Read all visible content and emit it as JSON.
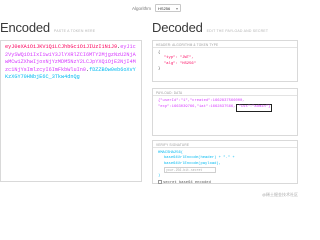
{
  "algorithm": {
    "label": "Algorithm",
    "selected": "HS256"
  },
  "encoded": {
    "title": "Encoded",
    "subtitle": "PASTE A TOKEN HERE",
    "token_header": "eyJ0eXAiOiJKV1QiLCJhbGciOiJIUzI1NiJ9",
    "token_payload": "eyJ1c2VySWQiOiIxIiwiY3JlYXRlZCI6MTY2MjgzNzU2NjAwMCwiZXhwIjoxNjYzMDM5NzY2LCJpYXQiOjE2NjI4Mzc1NjYsImlzcyI6ImFkbWluIn0",
    "token_signature": "fDZZBOw0eb6oXvYKzXGY70HNbjE6C_3Tkw4dnQg"
  },
  "decoded": {
    "title": "Decoded",
    "subtitle": "EDIT THE PAYLOAD AND SECRET",
    "header": {
      "title": "HEADER: ALGORITHM & TOKEN TYPE",
      "open": "{",
      "lines": [
        "\"typ\": \"JWT\",",
        "\"alg\": \"HS256\""
      ],
      "close": "}"
    },
    "payload": {
      "title": "PAYLOAD: DATA",
      "line1": "{\"userId\":\"1\",\"created\":1662837566000,",
      "line2": "\"exp\":1663039766,\"iat\":1662837566,",
      "highlight": "\"iss\":\"admin\"}"
    },
    "signature": {
      "title": "VERIFY SIGNATURE",
      "lines": [
        "HMACSHA256(",
        "base64UrlEncode(header) + \".\" +",
        "base64UrlEncode(payload),"
      ],
      "secret_placeholder": "your-256-bit-secret",
      "close": ")",
      "checkbox_label": "secret base64 encoded"
    }
  },
  "watermark": "@稀土掘金技术社区",
  "colors": {
    "header": "#fb015b",
    "payload": "#d63aff",
    "signature": "#00b9f1"
  }
}
